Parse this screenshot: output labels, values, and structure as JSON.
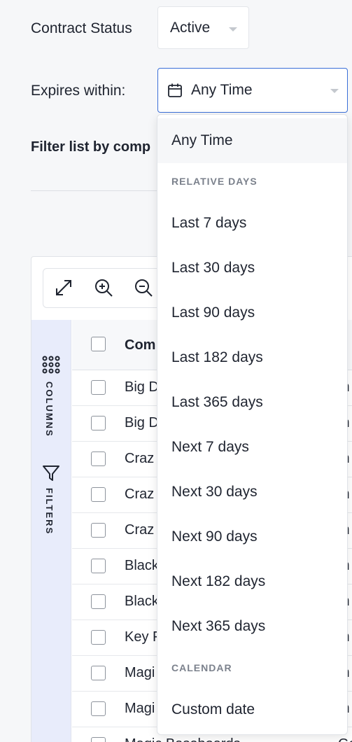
{
  "filters": {
    "contract_status_label": "Contract Status",
    "contract_status_value": "Active",
    "expires_label": "Expires within:",
    "expires_value": "Any Time",
    "filter_by_label": "Filter list by comp"
  },
  "sidebar": {
    "columns_label": "COLUMNS",
    "filters_label": "FILTERS"
  },
  "grid": {
    "header_label": "Com",
    "rows": [
      {
        "name": "Big D",
        "col2": "m"
      },
      {
        "name": "Big D",
        "col2": "m"
      },
      {
        "name": "Craz",
        "col2": "m"
      },
      {
        "name": "Craz",
        "col2": "m"
      },
      {
        "name": "Craz",
        "col2": "m"
      },
      {
        "name": "Black",
        "col2": "m"
      },
      {
        "name": "Black",
        "col2": "m"
      },
      {
        "name": "Key F",
        "col2": "m"
      },
      {
        "name": "Magi",
        "col2": "m"
      },
      {
        "name": "Magi",
        "col2": "m"
      },
      {
        "name": "Magic Baseboards",
        "col2": "Gold"
      }
    ]
  },
  "menu": {
    "top_item": "Any Time",
    "relative_header": "RELATIVE DAYS",
    "relative_items": [
      "Last 7 days",
      "Last 30 days",
      "Last 90 days",
      "Last 182 days",
      "Last 365 days",
      "Next 7 days",
      "Next 30 days",
      "Next 90 days",
      "Next 182 days",
      "Next 365 days"
    ],
    "calendar_header": "CALENDAR",
    "calendar_item": "Custom date"
  },
  "colors": {
    "accent_border": "#3a6fd8",
    "sidebar_strip": "#e8ecfb",
    "page_bg": "#f6f7f9"
  }
}
